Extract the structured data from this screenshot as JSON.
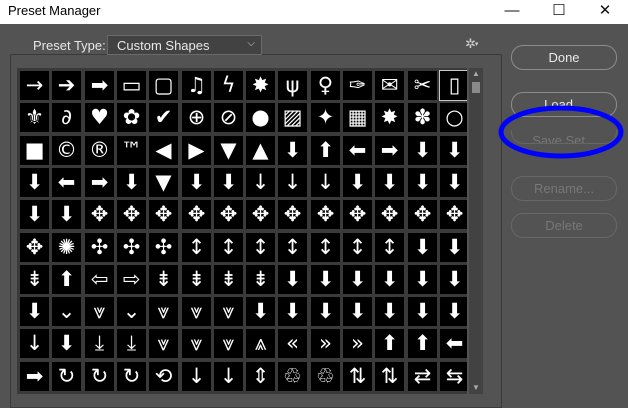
{
  "window": {
    "title": "Preset Manager"
  },
  "controls": {
    "minimize": "—",
    "maximize": "☐",
    "close": "✕"
  },
  "preset": {
    "label": "Preset Type:",
    "selected": "Custom Shapes",
    "dropdown_icon": "chevron-down-icon",
    "menu_icon": "gear-icon"
  },
  "buttons": {
    "done": "Done",
    "load": "Load...",
    "save_set": "Save Set...",
    "rename": "Rename...",
    "delete": "Delete"
  },
  "annotation": {
    "color": "#0000ff"
  },
  "shapes": [
    [
      "→",
      "➔",
      "➡",
      "▭",
      "▢",
      "♫",
      "ϟ",
      "✸",
      "ψ",
      "♀",
      "✑",
      "✉",
      "✂",
      "▯"
    ],
    [
      "⚜",
      "∂",
      "♥",
      "✿",
      "✔",
      "⊕",
      "⊘",
      "●",
      "▨",
      "✦",
      "▦",
      "✸",
      "✽",
      "○"
    ],
    [
      "■",
      "©",
      "®",
      "™",
      "◀",
      "▶",
      "▼",
      "▲",
      "⬇",
      "⬆",
      "⬅",
      "➡",
      "⬇",
      "⬇"
    ],
    [
      "⬇",
      "⬅",
      "➡",
      "⬇",
      "▼",
      "⬇",
      "⬇",
      "↓",
      "↓",
      "↓",
      "⬇",
      "⬇",
      "⬇",
      "⬇"
    ],
    [
      "⬇",
      "⬇",
      "✥",
      "✥",
      "✥",
      "✥",
      "✥",
      "✥",
      "✥",
      "✥",
      "✥",
      "✥",
      "✥",
      "✥"
    ],
    [
      "✥",
      "✺",
      "✣",
      "✣",
      "✣",
      "↕",
      "↕",
      "↕",
      "↕",
      "↕",
      "↕",
      "↕",
      "⬇",
      "⬇"
    ],
    [
      "⇟",
      "⬆",
      "⇦",
      "⇨",
      "⇟",
      "⇟",
      "⇟",
      "⇟",
      "⬇",
      "⬇",
      "⬇",
      "⬇",
      "⬇",
      "⬇"
    ],
    [
      "⬇",
      "⌄",
      "⩔",
      "⌄",
      "⩔",
      "⩔",
      "⩔",
      "⬇",
      "⬇",
      "⬇",
      "⬇",
      "⬇",
      "⬇",
      "⬇"
    ],
    [
      "↓",
      "⬇",
      "⤓",
      "⤓",
      "⩔",
      "⩔",
      "⩔",
      "⩓",
      "«",
      "»",
      "»",
      "⬆",
      "⬆",
      "⬅"
    ],
    [
      "➡",
      "↻",
      "↻",
      "↻",
      "⟲",
      "↓",
      "↓",
      "⇕",
      "♲",
      "♲",
      "⇅",
      "⇅",
      "⇄",
      "⇆"
    ]
  ]
}
